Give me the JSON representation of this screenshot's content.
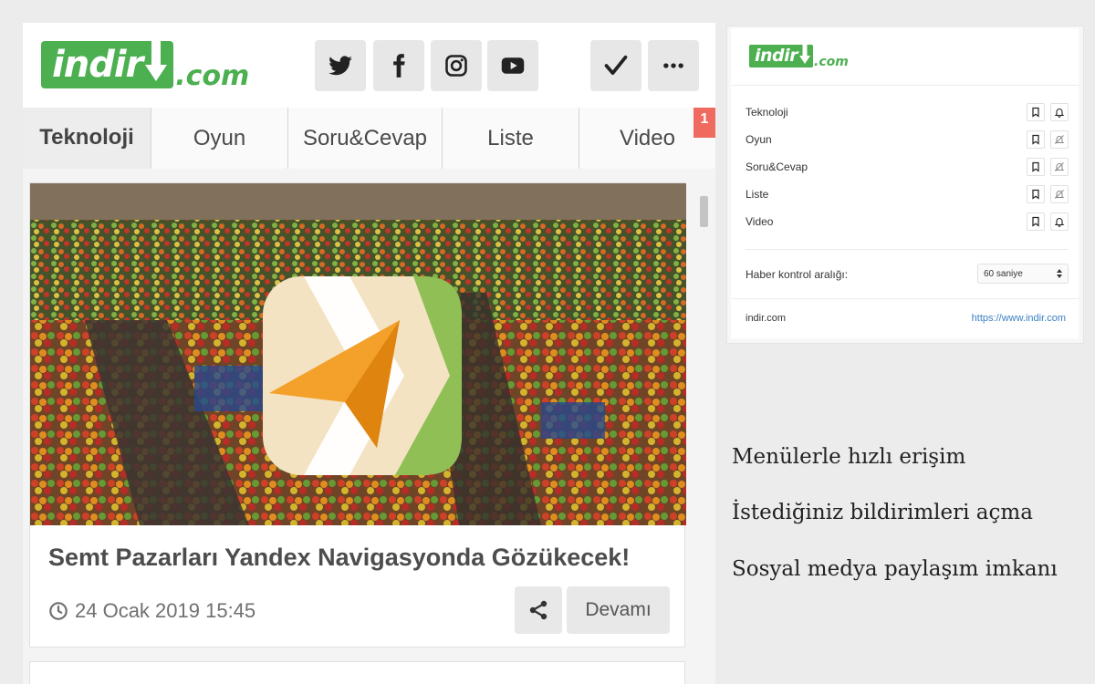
{
  "logo": {
    "main": "indir",
    "suffix": ".com"
  },
  "header_buttons": [
    {
      "name": "twitter-button",
      "icon": "twitter-icon"
    },
    {
      "name": "facebook-button",
      "icon": "facebook-icon"
    },
    {
      "name": "instagram-button",
      "icon": "instagram-icon"
    },
    {
      "name": "youtube-button",
      "icon": "youtube-icon"
    },
    {
      "name": "check-button",
      "icon": "check-icon"
    },
    {
      "name": "more-button",
      "icon": "more-dots-icon"
    }
  ],
  "tabs": [
    {
      "label": "Teknoloji",
      "active": true
    },
    {
      "label": "Oyun",
      "active": false
    },
    {
      "label": "Soru&Cevap",
      "active": false
    },
    {
      "label": "Liste",
      "active": false
    },
    {
      "label": "Video",
      "active": false
    }
  ],
  "notification_count": "1",
  "article": {
    "title": "Semt Pazarları Yandex Navigasyonda Gözükecek!",
    "date": "24 Ocak 2019 15:45",
    "read_more": "Devamı"
  },
  "popup": {
    "logo": {
      "main": "indir",
      "suffix": ".com"
    },
    "categories": [
      {
        "label": "Teknoloji",
        "notifications": "on"
      },
      {
        "label": "Oyun",
        "notifications": "off"
      },
      {
        "label": "Soru&Cevap",
        "notifications": "off"
      },
      {
        "label": "Liste",
        "notifications": "off"
      },
      {
        "label": "Video",
        "notifications": "on"
      }
    ],
    "interval_label": "Haber kontrol aralığı:",
    "interval_value": "60 saniye",
    "footer_left": "indir.com",
    "footer_right": "https://www.indir.com"
  },
  "features": [
    "Menülerle hızlı erişim",
    "İstediğiniz bildirimleri açma",
    "Sosyal medya paylaşım imkanı"
  ],
  "colors": {
    "brand": "#4caf50",
    "badge": "#f06b5f",
    "link": "#3a7fc4",
    "nav_orange": "#f4a12b"
  }
}
